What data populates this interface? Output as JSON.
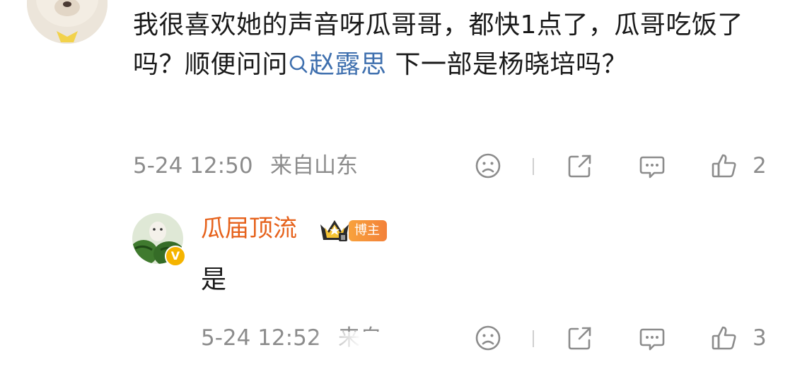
{
  "comment": {
    "text_before": "我很喜欢她的声音呀瓜哥哥，都快1点了，瓜哥吃饭了吗？顺便问问",
    "topic_icon": "search-icon",
    "topic": "赵露思",
    "text_after": " 下一部是杨晓培吗？",
    "time": "5-24 12:50",
    "source": "来自山东",
    "like_count": "2"
  },
  "reply": {
    "name": "瓜届顶流",
    "badge": "博主",
    "text": "是",
    "time": "5-24 12:52",
    "source": "来自",
    "like_count": "3"
  },
  "colors": {
    "name": "#e6621c",
    "topic": "#3e6fae",
    "meta": "#8c8c8c"
  }
}
